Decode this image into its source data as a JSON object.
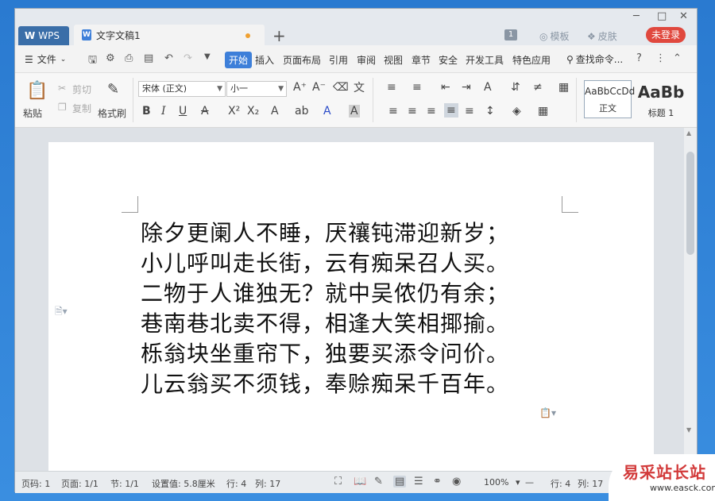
{
  "titlebar": {
    "wps_tab": "WPS",
    "doc_tab": "文字文稿1",
    "plus": "+",
    "badge": "1",
    "template_label": "模板",
    "skin_label": "皮肤",
    "login_label": "未登录",
    "controls": [
      "☐",
      "▢",
      "✕"
    ]
  },
  "menu": {
    "file": "文件",
    "tabs": [
      "开始",
      "插入",
      "页面布局",
      "引用",
      "审阅",
      "视图",
      "章节",
      "安全",
      "开发工具",
      "特色应用"
    ],
    "find": "查找命令...",
    "help": "?"
  },
  "ribbon": {
    "paste": "粘贴",
    "cut": "剪切",
    "copy": "复制",
    "format_painter": "格式刷",
    "font_name": "宋体 (正文)",
    "font_size": "小一",
    "styles": [
      {
        "preview": "AaBbCcDd",
        "name": "正文"
      },
      {
        "preview": "AaBb",
        "name": "标题 1"
      }
    ]
  },
  "document": {
    "lines": [
      "除夕更阑人不睡，厌禳钝滞迎新岁；",
      "小儿呼叫走长街，云有痴呆召人买。",
      "二物于人谁独无？就中吴侬仍有余；",
      "巷南巷北卖不得，相逢大笑相揶揄。",
      "栎翁块坐重帘下，独要买添令问价。",
      "儿云翁买不须钱，奉赊痴呆千百年。"
    ]
  },
  "status": {
    "page_num": "页码: 1",
    "pages": "页面: 1/1",
    "section": "节: 1/1",
    "setting": "设置值: 5.8厘米",
    "row": "行: 4",
    "col": "列: 17",
    "zoom": "100%",
    "row2": "行: 4",
    "col2": "列: 17"
  },
  "watermark": {
    "main": "易采站长站",
    "url": "www.easck.com"
  },
  "colors": {
    "accent": "#3d7fd9",
    "login": "#e0483e",
    "watermark": "#d23a3a"
  }
}
